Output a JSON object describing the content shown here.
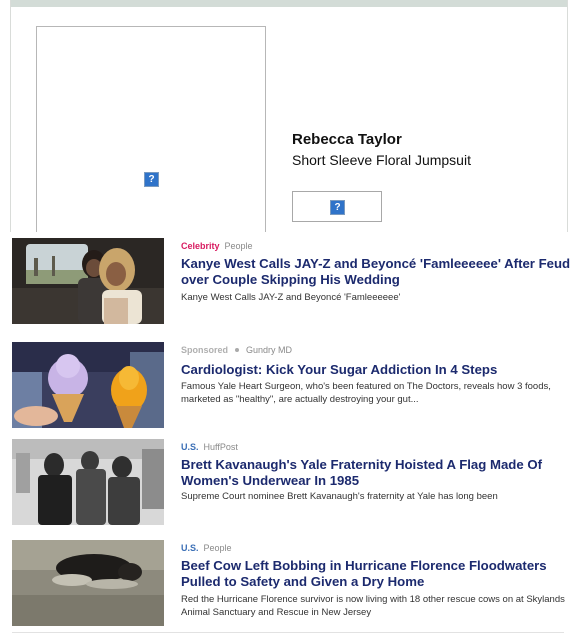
{
  "ad": {
    "brand": "Rebecca Taylor",
    "product": "Short Sleeve Floral Jumpsuit",
    "broken_image_glyph": "?",
    "button_glyph": "?"
  },
  "stories": [
    {
      "category": "Celebrity",
      "category_color": "#d81b60",
      "source": "People",
      "headline": "Kanye West Calls JAY-Z and Beyoncé 'Famleeeeee' After Feud over Couple Skipping His Wedding",
      "description": "Kanye West Calls JAY-Z and Beyoncé 'Famleeeeee'"
    },
    {
      "category": "Sponsored",
      "category_color": "#9a9a9a",
      "source": "Gundry MD",
      "headline": "Cardiologist: Kick Your Sugar Addiction In 4 Steps",
      "description": "Famous Yale Heart Surgeon, who's been featured on The Doctors, reveals how 3 foods, marketed as \"healthy\", are actually destroying your gut..."
    },
    {
      "category": "U.S.",
      "category_color": "#3b6fb6",
      "source": "HuffPost",
      "headline": "Brett Kavanaugh's Yale Fraternity Hoisted A Flag Made Of Women's Underwear In 1985",
      "description": "Supreme Court nominee Brett Kavanaugh's fraternity at Yale has long been"
    },
    {
      "category": "U.S.",
      "category_color": "#3b6fb6",
      "source": "People",
      "headline": "Beef Cow Left Bobbing in Hurricane Florence Floodwaters Pulled to Safety and Given a Dry Home",
      "description": "Red the Hurricane Florence survivor is now living with 18 other rescue cows on at Skylands Animal Sanctuary and Rescue in New Jersey"
    }
  ]
}
